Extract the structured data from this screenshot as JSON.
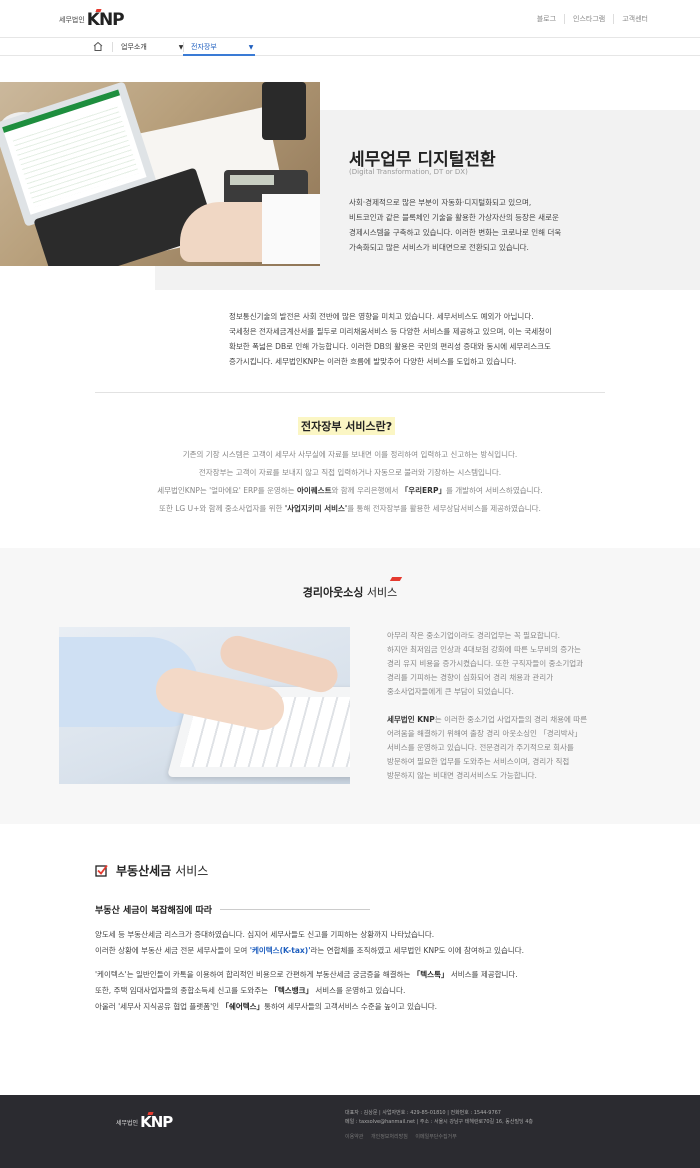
{
  "header": {
    "logo_small": "세무법인",
    "logo_main": "KNP",
    "links": [
      "블로그",
      "인스타그램",
      "고객센터"
    ]
  },
  "subnav": {
    "items": [
      {
        "label": "업무소개"
      },
      {
        "label": "전자장부"
      }
    ]
  },
  "hero": {
    "title": "세무업무 디지털전환",
    "subtitle": "(Digital Transformation, DT or DX)",
    "lines": [
      "사회·경제적으로 많은 부분이 자동화·디지털화되고 있으며,",
      "비트코인과 같은 블록체인 기술을 활용한 가상자산의 등장은 새로운",
      "경제시스템을 구축하고 있습니다. 이러한 변화는 코로나로 인해 더욱",
      "가속화되고 많은 서비스가 비대면으로 전환되고 있습니다."
    ]
  },
  "intro": {
    "lines": [
      "정보통신기술의 발전은 사회 전반에 많은 영향을 미치고 있습니다. 세무서비스도 예외가 아닙니다.",
      "국세청은 전자세금계산서를 필두로 미리채움서비스 등 다양한 서비스를 제공하고 있으며, 이는 국세청이",
      "확보한 폭넓은 DB로 인해 가능합니다. 이러한 DB의 활용은 국민의 편리성 증대와 동시에 세무리스크도",
      "증가시킵니다. 세무법인KNP는 이러한 흐름에 발맞추어 다양한 서비스를 도입하고 있습니다."
    ]
  },
  "ebook": {
    "title": "전자장부 서비스란?",
    "line1": "기존의 기장 시스템은 고객이 세무사 사무실에 자료를 보내면 이를 정리하여 입력하고 신고하는 방식입니다.",
    "line2": "전자장부는 고객이 자료를 보내지 않고 직접 입력하거나 자동으로 불러와 기장하는 시스템입니다.",
    "line3a": "세무법인KNP는 '얼마에요' ERP를 운영하는 ",
    "line3b": "아이퀘스트",
    "line3c": "와 함께 우리은행에서 ",
    "line3d": "「우리ERP」",
    "line3e": "를 개발하여 서비스하였습니다.",
    "line4a": "또한 LG U+와 함께 중소사업자를 위한 ",
    "line4b": "'사업지키미 서비스'",
    "line4c": "를 통해 전자장부를 활용한 세무상담서비스를 제공하였습니다."
  },
  "outsourcing": {
    "title_bold": "경리아웃소싱",
    "title_rest": " 서비스",
    "para1": [
      "아무리 작은 중소기업이라도 경리업무는 꼭 필요합니다.",
      "하지만 최저임금 인상과 4대보험 강화에 따른 노무비의 증가는",
      "경리 유지 비용을 증가시켰습니다. 또한 구직자들이 중소기업과",
      "경리를 기피하는 경향이 심화되어 경리 채용과 관리가",
      "중소사업자들에게 큰 부담이 되었습니다."
    ],
    "para2_bold": "세무법인 KNP",
    "para2_first": "는 이러한 중소기업 사업자들의 경리 채용에 따른",
    "para2": [
      "어려움을 해결하기 위해여 출장 경리 아웃소싱인 「경리박사」",
      "서비스를 운영하고 있습니다. 전문경리가 주기적으로 회사를",
      "방문하여 필요한 업무를 도와주는 서비스이며, 경리가 직접",
      "방문하지 않는 비대면 경리서비스도 가능합니다."
    ]
  },
  "realestate": {
    "title_bold": "부동산세금",
    "title_rest": "서비스",
    "subheading": "부동산 세금이 복잡해짐에 따라",
    "p1_l1": "양도세 등 부동산세금 리스크가 증대하였습니다. 심지어 세무사들도 신고를 기피하는 상황까지 나타났습니다.",
    "p1_l2a": "이러한 상황에 부동산 세금 전문 세무사들이 모여 ",
    "p1_l2b": "'케이텍스(K-tax)'",
    "p1_l2c": "라는 연합체를 조직하였고 세무법인 KNP도 이에 참여하고 있습니다.",
    "p2_l1a": "'케이텍스'는 일반인들이 카톡을 이용하여 합리적인 비용으로 간편하게 부동산세금 궁금증을 해결하는 ",
    "p2_l1b": "「텍스톡」",
    "p2_l1c": " 서비스를 제공합니다.",
    "p2_l2a": "또한, 주택 임대사업자들의 종합소득세 신고를 도와주는 ",
    "p2_l2b": "「텍스뱅크」",
    "p2_l2c": " 서비스를 운영하고 있습니다.",
    "p2_l3a": "아울러 '세무사 지식공유 협업 플랫폼'인 ",
    "p2_l3b": "「쉐어텍스」",
    "p2_l3c": "통하여 세무사들의 고객서비스 수준을 높이고 있습니다."
  },
  "footer": {
    "logo_small": "세무법인",
    "logo_main": "KNP",
    "info1": "대표자 : 김상문   |   사업자번호 : 429-85-01810   |   전화번호 : 1544-9767",
    "info2": "메일 : taxsolve@hanmail.net   |   주소 : 서울시 강남구 테헤란로70길 16, 동산빌딩 4층",
    "links": [
      "이용약관",
      "개인정보처리방침",
      "이메일무단수집거부"
    ]
  }
}
